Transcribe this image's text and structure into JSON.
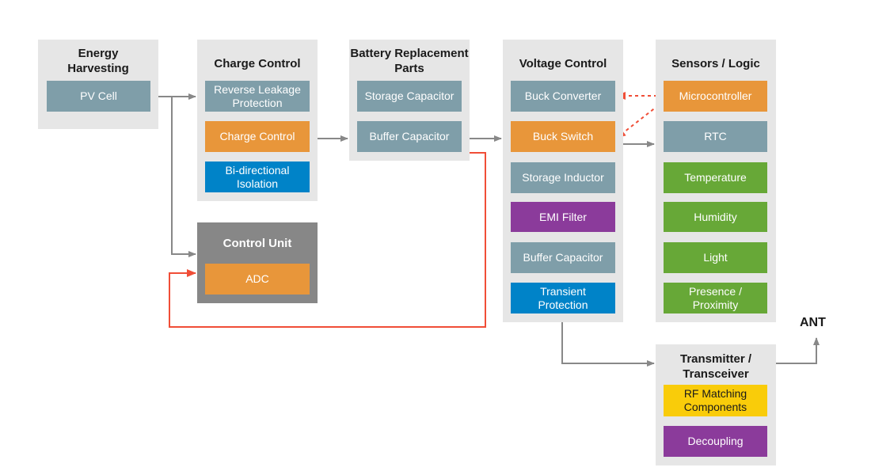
{
  "colors": {
    "group": "#e6e6e6",
    "control_unit": "#878787",
    "gray": "#7f9ea9",
    "orange": "#e8963a",
    "blue": "#0083c8",
    "purple": "#8b3b9b",
    "green": "#67a837",
    "yellow": "#f9cc0a",
    "arrow": "#888888",
    "signal": "#f04e37"
  },
  "groups": {
    "energy": {
      "title": "Energy Harvesting",
      "items": [
        "PV Cell"
      ]
    },
    "charge": {
      "title": "Charge Control",
      "items": [
        "Reverse Leakage Protection",
        "Charge Control",
        "Bi-directional Isolation"
      ]
    },
    "control": {
      "title": "Control Unit",
      "items": [
        "ADC"
      ]
    },
    "battery": {
      "title": "Battery Replacement Parts",
      "items": [
        "Storage Capacitor",
        "Buffer Capacitor"
      ]
    },
    "voltage": {
      "title": "Voltage Control",
      "items": [
        "Buck Converter",
        "Buck Switch",
        "Storage Inductor",
        "EMI Filter",
        "Buffer Capacitor",
        "Transient Protection"
      ]
    },
    "sensors": {
      "title": "Sensors / Logic",
      "items": [
        "Microcontroller",
        "RTC",
        "Temperature",
        "Humidity",
        "Light",
        "Presence / Proximity"
      ]
    },
    "tx": {
      "title": "Transmitter / Transceiver",
      "items": [
        "RF Matching Components",
        "Decoupling"
      ]
    }
  },
  "antenna": "ANT"
}
